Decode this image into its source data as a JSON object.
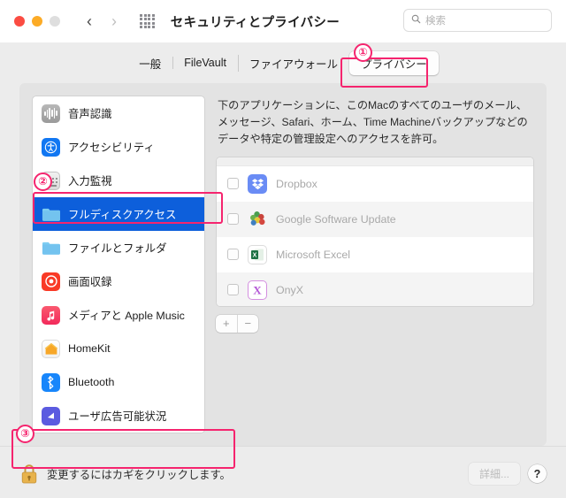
{
  "window": {
    "title": "セキュリティとプライバシー",
    "traffic_lights": [
      "close",
      "minimize",
      "zoom"
    ],
    "nav_back": "‹",
    "nav_forward": "›",
    "grid_icon": "grid-icon"
  },
  "search": {
    "placeholder": "検索",
    "icon": "search-icon"
  },
  "tabs": [
    {
      "label": "一般",
      "selected": false
    },
    {
      "label": "FileVault",
      "selected": false
    },
    {
      "label": "ファイアウォール",
      "selected": false
    },
    {
      "label": "プライバシー",
      "selected": true
    }
  ],
  "sidebar": {
    "items": [
      {
        "label": "音声認識",
        "icon": "speech-recognition-icon",
        "selected": false
      },
      {
        "label": "アクセシビリティ",
        "icon": "accessibility-icon",
        "selected": false
      },
      {
        "label": "入力監視",
        "icon": "input-monitoring-icon",
        "selected": false
      },
      {
        "label": "フルディスクアクセス",
        "icon": "full-disk-access-icon",
        "selected": true
      },
      {
        "label": "ファイルとフォルダ",
        "icon": "files-and-folders-icon",
        "selected": false
      },
      {
        "label": "画面収録",
        "icon": "screen-recording-icon",
        "selected": false
      },
      {
        "label": "メディアと Apple Music",
        "icon": "media-apple-music-icon",
        "selected": false
      },
      {
        "label": "HomeKit",
        "icon": "homekit-icon",
        "selected": false
      },
      {
        "label": "Bluetooth",
        "icon": "bluetooth-icon",
        "selected": false
      },
      {
        "label": "ユーザ広告可能状況",
        "icon": "user-advertising-icon",
        "selected": false
      }
    ]
  },
  "content": {
    "description": "下のアプリケーションに、このMacのすべてのユーザのメール、メッセージ、Safari、ホーム、Time Machineバックアップなどのデータや特定の管理設定へのアクセスを許可。",
    "apps": [
      {
        "name": "Dropbox",
        "icon": "dropbox-icon",
        "checked": false
      },
      {
        "name": "Google Software Update",
        "icon": "google-software-update-icon",
        "checked": false
      },
      {
        "name": "Microsoft Excel",
        "icon": "microsoft-excel-icon",
        "checked": false
      },
      {
        "name": "OnyX",
        "icon": "onyx-icon",
        "checked": false
      }
    ],
    "add_label": "+",
    "remove_label": "−"
  },
  "footer": {
    "lock_icon": "locked-padlock-icon",
    "lock_text": "変更するにはカギをクリックします。",
    "details_label": "詳細...",
    "help_label": "?"
  },
  "annotations": {
    "markers": [
      {
        "number": "①",
        "target": "privacy-tab"
      },
      {
        "number": "②",
        "target": "full-disk-access-sidebar-item"
      },
      {
        "number": "③",
        "target": "lock-button"
      }
    ],
    "highlight_color": "#f5246e"
  }
}
